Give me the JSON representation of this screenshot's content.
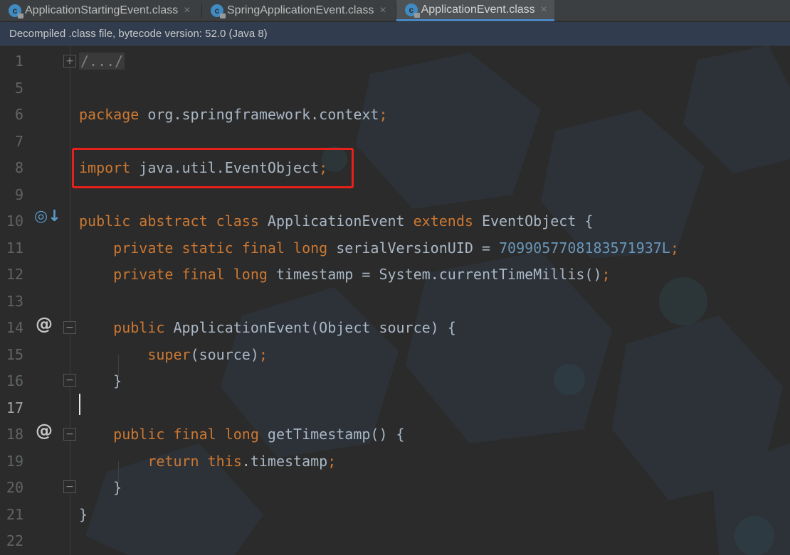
{
  "tabs": [
    {
      "label": "ApplicationStartingEvent.class",
      "close": "×",
      "active": false
    },
    {
      "label": "SpringApplicationEvent.class",
      "close": "×",
      "active": false
    },
    {
      "label": "ApplicationEvent.class",
      "close": "×",
      "active": true
    }
  ],
  "tab_icon_letter": "c",
  "notice": "Decompiled .class file, bytecode version: 52.0 (Java 8)",
  "gutter_icons": {
    "implements_icon": "◎↓",
    "override_icon": "@"
  },
  "fold_markers": {
    "expand": "+",
    "collapse": "−"
  },
  "lines": [
    {
      "n": "1",
      "parts": [
        {
          "t": "/.../",
          "c": "fold-box"
        }
      ]
    },
    {
      "n": "5",
      "parts": []
    },
    {
      "n": "6",
      "parts": [
        {
          "t": "package ",
          "c": "kw"
        },
        {
          "t": "org.springframework.context",
          "c": ""
        },
        {
          "t": ";",
          "c": "kw"
        }
      ]
    },
    {
      "n": "7",
      "parts": []
    },
    {
      "n": "8",
      "parts": [
        {
          "t": "import ",
          "c": "kw"
        },
        {
          "t": "java.util.EventObject",
          "c": ""
        },
        {
          "t": ";",
          "c": "kw"
        }
      ]
    },
    {
      "n": "9",
      "parts": []
    },
    {
      "n": "10",
      "parts": [
        {
          "t": "public abstract class ",
          "c": "kw"
        },
        {
          "t": "ApplicationEvent ",
          "c": ""
        },
        {
          "t": "extends ",
          "c": "kw"
        },
        {
          "t": "EventObject {",
          "c": ""
        }
      ]
    },
    {
      "n": "11",
      "parts": [
        {
          "t": "    private static final long ",
          "c": "kw"
        },
        {
          "t": "serialVersionUID = ",
          "c": ""
        },
        {
          "t": "7099057708183571937L",
          "c": "num"
        },
        {
          "t": ";",
          "c": "kw"
        }
      ]
    },
    {
      "n": "12",
      "parts": [
        {
          "t": "    private final long ",
          "c": "kw"
        },
        {
          "t": "timestamp = System.currentTimeMillis()",
          "c": ""
        },
        {
          "t": ";",
          "c": "kw"
        }
      ]
    },
    {
      "n": "13",
      "parts": []
    },
    {
      "n": "14",
      "parts": [
        {
          "t": "    public ",
          "c": "kw"
        },
        {
          "t": "ApplicationEvent(Object source) {",
          "c": ""
        }
      ]
    },
    {
      "n": "15",
      "parts": [
        {
          "t": "        super",
          "c": "kw"
        },
        {
          "t": "(source)",
          "c": ""
        },
        {
          "t": ";",
          "c": "kw"
        }
      ]
    },
    {
      "n": "16",
      "parts": [
        {
          "t": "    }",
          "c": ""
        }
      ]
    },
    {
      "n": "17",
      "parts": []
    },
    {
      "n": "18",
      "parts": [
        {
          "t": "    public final long ",
          "c": "kw"
        },
        {
          "t": "getTimestamp() {",
          "c": ""
        }
      ]
    },
    {
      "n": "19",
      "parts": [
        {
          "t": "        return this",
          "c": "kw"
        },
        {
          "t": ".timestamp",
          "c": ""
        },
        {
          "t": ";",
          "c": "kw"
        }
      ]
    },
    {
      "n": "20",
      "parts": [
        {
          "t": "    }",
          "c": ""
        }
      ]
    },
    {
      "n": "21",
      "parts": [
        {
          "t": "}",
          "c": ""
        }
      ]
    },
    {
      "n": "22",
      "parts": []
    }
  ],
  "current_line": "17",
  "colors": {
    "keyword": "#cc7832",
    "number": "#6897bb",
    "text": "#a9b7c6",
    "highlight_box": "#e8201c",
    "tab_accent": "#4a88c7"
  }
}
